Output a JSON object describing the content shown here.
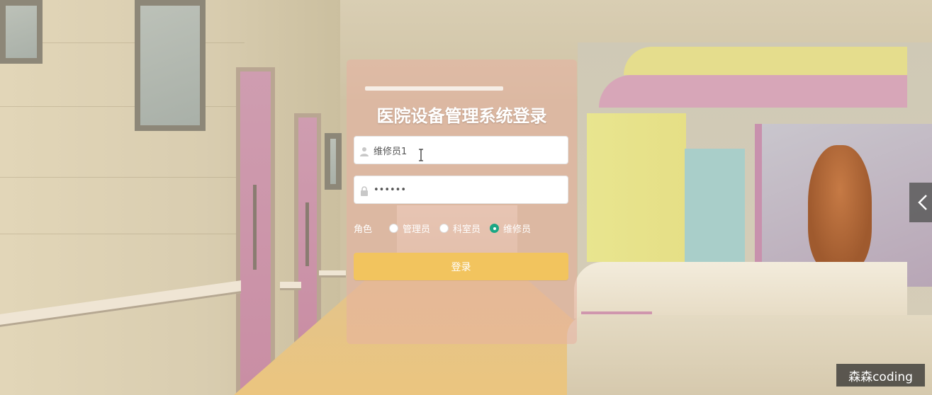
{
  "app": {
    "title": "医院设备管理系统登录"
  },
  "login": {
    "username_value": "维修员1",
    "password_value": "••••••",
    "role_label": "角色",
    "roles": [
      {
        "label": "管理员",
        "checked": false
      },
      {
        "label": "科室员",
        "checked": false
      },
      {
        "label": "维修员",
        "checked": true
      }
    ],
    "submit_label": "登录"
  },
  "icons": {
    "username": "user-icon",
    "password": "lock-icon",
    "carousel": "chevron-left-icon"
  },
  "colors": {
    "card_bg": "#e8b0a0",
    "button": "#f2c45e",
    "radio_checked": "#1ba784",
    "title": "#ffffff"
  },
  "watermark": {
    "text": "森森coding"
  }
}
